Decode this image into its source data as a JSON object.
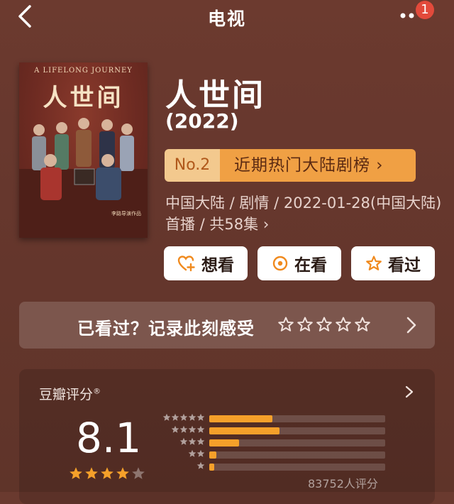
{
  "header": {
    "title": "电视",
    "notification_count": "1"
  },
  "poster": {
    "english_title": "A LIFELONG JOURNEY",
    "chinese_title": "人世间"
  },
  "show": {
    "title": "人世间",
    "year": "(2022)",
    "rank_number": "No.2",
    "rank_text": "近期热门大陆剧榜 ›",
    "meta": "中国大陆 / 剧情 / 2022-01-28(中国大陆)首播 / 共58集 ›"
  },
  "actions": {
    "want": "想看",
    "watching": "在看",
    "watched": "看过"
  },
  "record": {
    "text": "已看过？记录此刻感受"
  },
  "rating": {
    "label": "豆瓣评分",
    "registered_mark": "®",
    "score": "8.1",
    "score_stars_filled": 4,
    "distribution": [
      0.36,
      0.4,
      0.17,
      0.04,
      0.03
    ],
    "count_text": "83752人评分"
  },
  "colors": {
    "background": "#6a3a2f",
    "accent": "#f5a02a",
    "rank_bg": "#f0a044"
  }
}
